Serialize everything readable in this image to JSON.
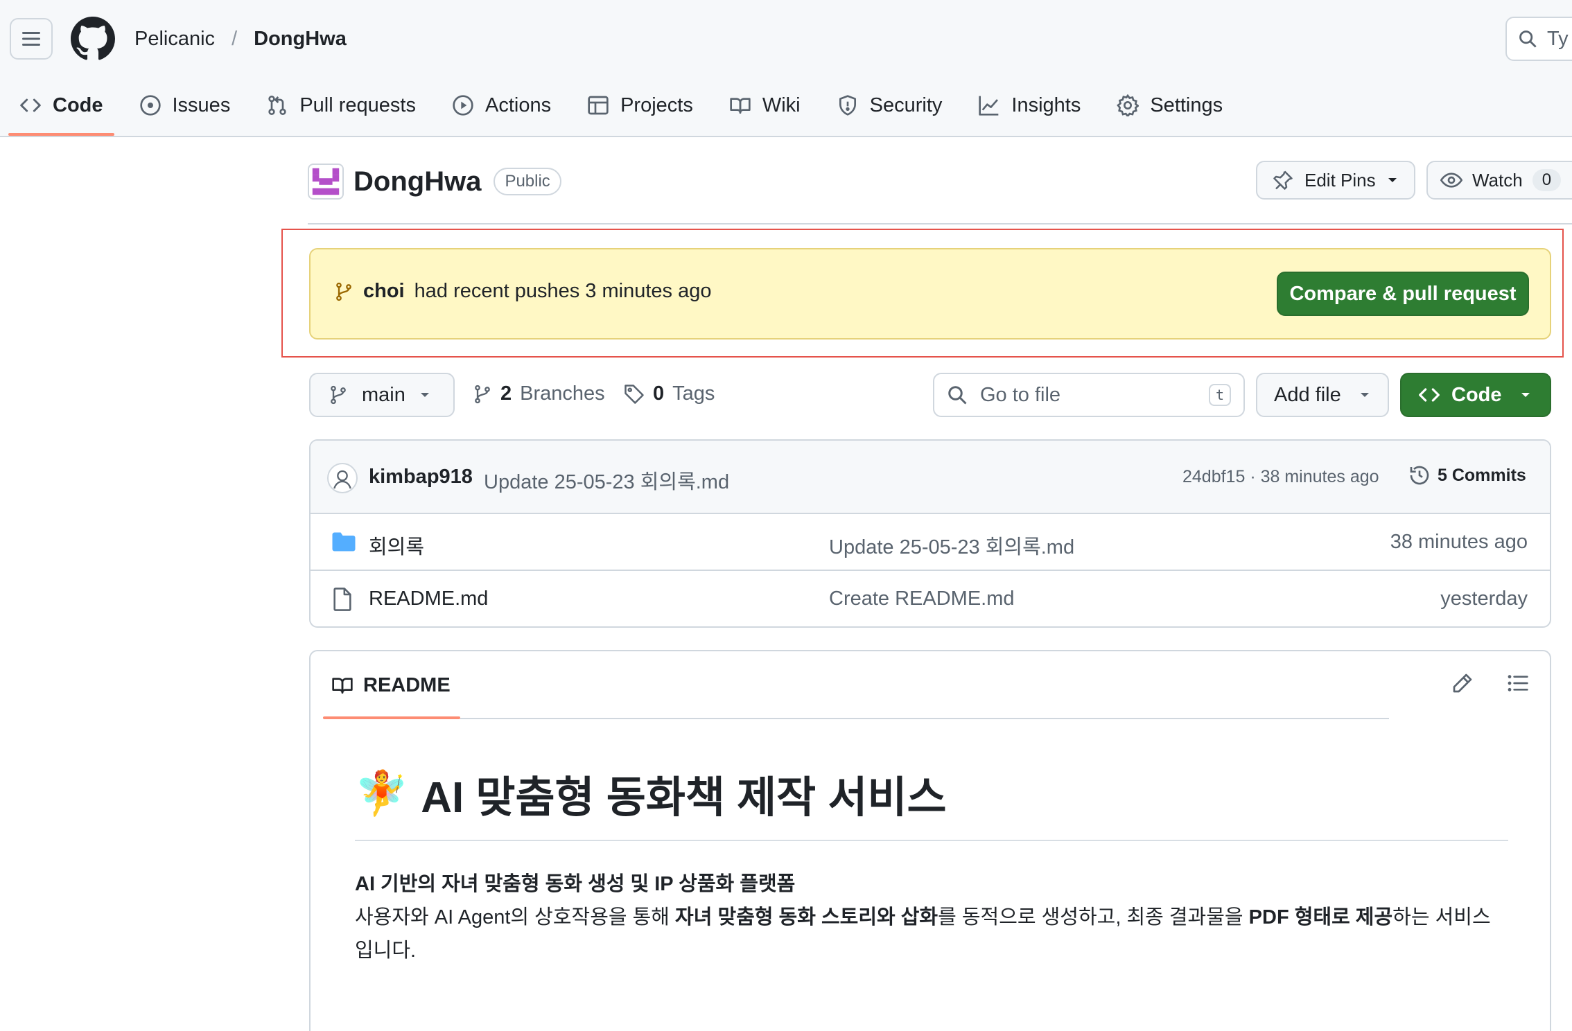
{
  "header": {
    "owner": "Pelicanic",
    "separator": "/",
    "repo": "DongHwa",
    "search_placeholder": "Ty"
  },
  "tabs": [
    {
      "label": "Code",
      "icon": "code-icon",
      "selected": true
    },
    {
      "label": "Issues",
      "icon": "issue-icon"
    },
    {
      "label": "Pull requests",
      "icon": "pull-request-icon"
    },
    {
      "label": "Actions",
      "icon": "play-icon"
    },
    {
      "label": "Projects",
      "icon": "table-icon"
    },
    {
      "label": "Wiki",
      "icon": "book-icon"
    },
    {
      "label": "Security",
      "icon": "shield-icon"
    },
    {
      "label": "Insights",
      "icon": "graph-icon"
    },
    {
      "label": "Settings",
      "icon": "gear-icon"
    }
  ],
  "repo": {
    "name": "DongHwa",
    "visibility": "Public",
    "edit_pins": "Edit Pins",
    "watch": "Watch",
    "watch_count": "0"
  },
  "push_banner": {
    "user": "choi",
    "text": "had recent pushes 3 minutes ago",
    "button": "Compare & pull request"
  },
  "file_nav": {
    "branch": "main",
    "branches_count": "2",
    "branches_label": "Branches",
    "tags_count": "0",
    "tags_label": "Tags",
    "goto_placeholder": "Go to file",
    "goto_hint": "t",
    "add_file": "Add file",
    "code": "Code"
  },
  "latest_commit": {
    "author": "kimbap918",
    "message": "Update 25-05-23 회의록.md",
    "meta": "24dbf15 · 38 minutes ago",
    "commits_label": "5 Commits"
  },
  "files": [
    {
      "icon": "folder-icon",
      "name": "회의록",
      "message": "Update 25-05-23 회의록.md",
      "date": "38 minutes ago"
    },
    {
      "icon": "file-icon",
      "name": "README.md",
      "message": "Create README.md",
      "date": "yesterday"
    }
  ],
  "readme": {
    "tab_label": "README",
    "emoji": "🧚",
    "title": "AI 맞춤형 동화책 제작 서비스",
    "subtitle": "AI 기반의 자녀 맞춤형 동화 생성 및 IP 상품화 플랫폼",
    "desc_1": "사용자와 AI Agent의 상호작용을 통해 ",
    "desc_bold_1": "자녀 맞춤형 동화 스토리와 삽화",
    "desc_2": "를 동적으로 생성하고, 최종 결과물을 ",
    "desc_bold_2": "PDF 형태로 제공",
    "desc_3": "하는 서비스입니다."
  },
  "colors": {
    "accent_green": "#2e7d32",
    "tab_underline": "#fd8c73",
    "banner_bg": "#fff8c5",
    "highlight_frame": "#e5534b",
    "folder_blue": "#54aeff",
    "avatar_purple": "#b44fc9"
  }
}
